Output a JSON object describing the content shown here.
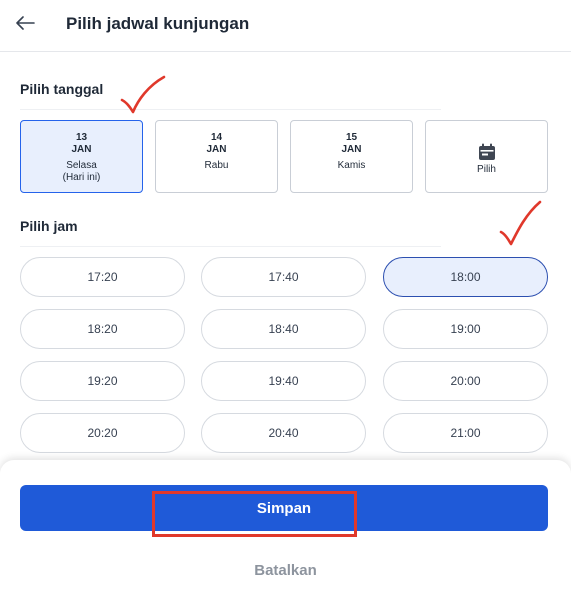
{
  "header": {
    "back_icon": "arrow-left-icon",
    "title": "Pilih jadwal kunjungan"
  },
  "date_section": {
    "title": "Pilih tanggal",
    "dates": [
      {
        "day_num": "13",
        "month": "JAN",
        "weekday": "Selasa",
        "note": "(Hari ini)",
        "selected": true
      },
      {
        "day_num": "14",
        "month": "JAN",
        "weekday": "Rabu",
        "note": "",
        "selected": false
      },
      {
        "day_num": "15",
        "month": "JAN",
        "weekday": "Kamis",
        "note": "",
        "selected": false
      }
    ],
    "picker": {
      "icon": "calendar-icon",
      "label": "Pilih"
    }
  },
  "time_section": {
    "title": "Pilih jam",
    "slots": [
      {
        "time": "17:20",
        "selected": false
      },
      {
        "time": "17:40",
        "selected": false
      },
      {
        "time": "18:00",
        "selected": true
      },
      {
        "time": "18:20",
        "selected": false
      },
      {
        "time": "18:40",
        "selected": false
      },
      {
        "time": "19:00",
        "selected": false
      },
      {
        "time": "19:20",
        "selected": false
      },
      {
        "time": "19:40",
        "selected": false
      },
      {
        "time": "20:00",
        "selected": false
      },
      {
        "time": "20:20",
        "selected": false
      },
      {
        "time": "20:40",
        "selected": false
      },
      {
        "time": "21:00",
        "selected": false
      }
    ]
  },
  "footer": {
    "save_label": "Simpan",
    "cancel_label": "Batalkan"
  },
  "annotations": {
    "check_icon": "checkmark-annotation-icon",
    "highlight_color": "#e0382b"
  },
  "colors": {
    "primary": "#1f5ad8",
    "selected_bg": "#e8effd",
    "selected_border": "#2563eb"
  }
}
